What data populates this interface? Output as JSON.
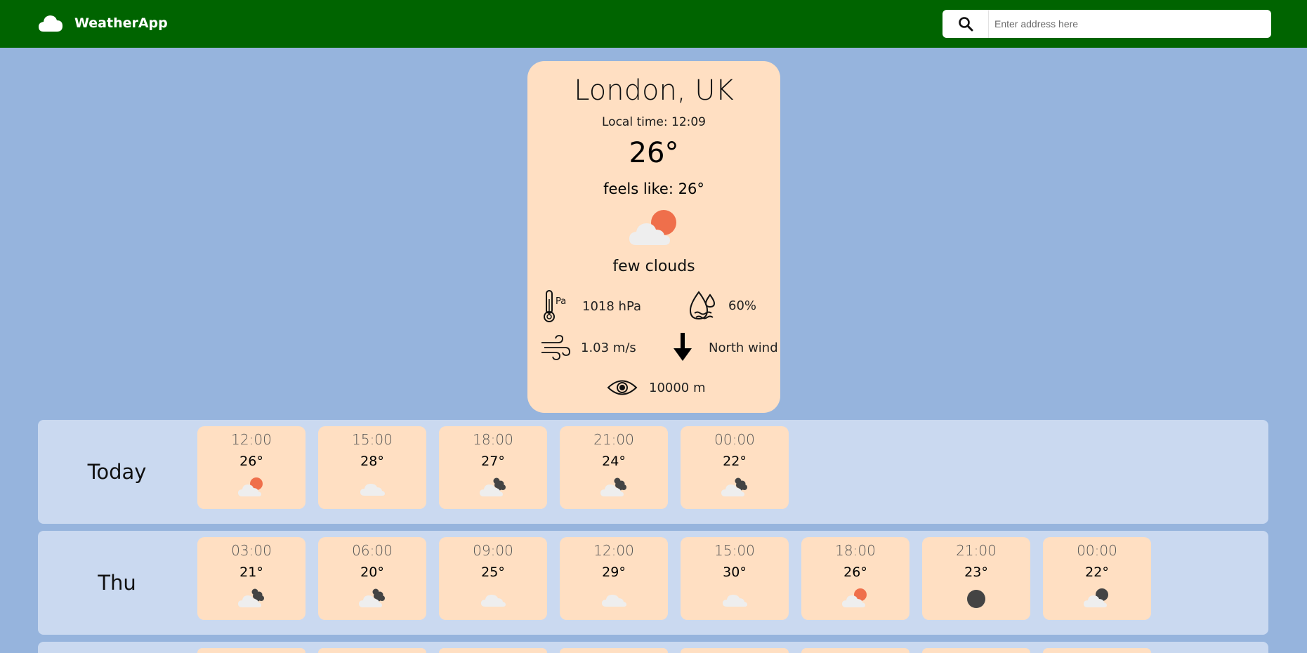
{
  "app": {
    "title": "WeatherApp"
  },
  "search": {
    "placeholder": "Enter address here",
    "value": ""
  },
  "current": {
    "city": "London, UK",
    "local_time": "Local time: 12:09",
    "temperature": "26°",
    "feels_like": "feels like: 26°",
    "description": "few clouds",
    "icon": "few-clouds-day",
    "pressure": "1018 hPa",
    "humidity": "60%",
    "wind_speed": "1.03 m/s",
    "wind_direction": "North wind",
    "visibility": "10000 m"
  },
  "forecast": [
    {
      "day": "Today",
      "hours": [
        {
          "time": "12:00",
          "temp": "26°",
          "icon": "few-clouds-day"
        },
        {
          "time": "15:00",
          "temp": "28°",
          "icon": "clouds"
        },
        {
          "time": "18:00",
          "temp": "27°",
          "icon": "few-clouds-night"
        },
        {
          "time": "21:00",
          "temp": "24°",
          "icon": "few-clouds-night"
        },
        {
          "time": "00:00",
          "temp": "22°",
          "icon": "few-clouds-night"
        }
      ]
    },
    {
      "day": "Thu",
      "hours": [
        {
          "time": "03:00",
          "temp": "21°",
          "icon": "few-clouds-night"
        },
        {
          "time": "06:00",
          "temp": "20°",
          "icon": "few-clouds-night"
        },
        {
          "time": "09:00",
          "temp": "25°",
          "icon": "clouds"
        },
        {
          "time": "12:00",
          "temp": "29°",
          "icon": "clouds"
        },
        {
          "time": "15:00",
          "temp": "30°",
          "icon": "clouds"
        },
        {
          "time": "18:00",
          "temp": "26°",
          "icon": "few-clouds-day"
        },
        {
          "time": "21:00",
          "temp": "23°",
          "icon": "clear-night"
        },
        {
          "time": "00:00",
          "temp": "22°",
          "icon": "few-clouds-moon"
        }
      ]
    }
  ],
  "colors": {
    "navbar": "#006400",
    "background": "#96b4dd",
    "card": "#ffdfc2",
    "row": "#cad9f0",
    "sun": "#ef6f4b",
    "cloud": "#eeeeee",
    "night": "#444444"
  }
}
